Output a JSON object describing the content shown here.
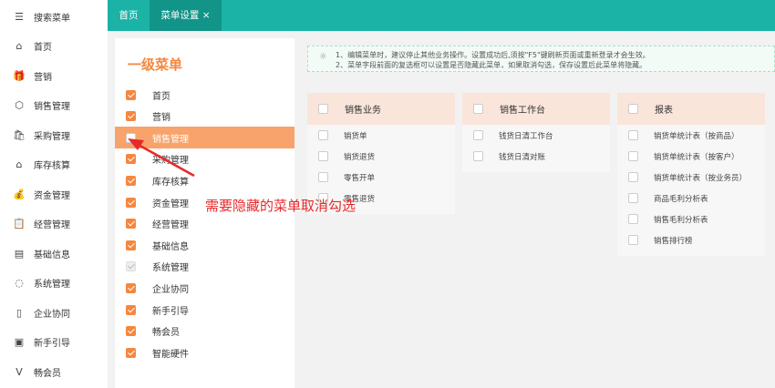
{
  "sidebar": {
    "items": [
      {
        "label": "搜索菜单",
        "icon": "search-menu-icon",
        "glyph": "☰"
      },
      {
        "label": "首页",
        "icon": "home-icon",
        "glyph": "⌂"
      },
      {
        "label": "营销",
        "icon": "gift-icon",
        "glyph": "🎁"
      },
      {
        "label": "销售管理",
        "icon": "sales-icon",
        "glyph": "⬡"
      },
      {
        "label": "采购管理",
        "icon": "bag-icon",
        "glyph": "🛍"
      },
      {
        "label": "库存核算",
        "icon": "warehouse-icon",
        "glyph": "⌂"
      },
      {
        "label": "资金管理",
        "icon": "money-bag-icon",
        "glyph": "💰"
      },
      {
        "label": "经营管理",
        "icon": "clipboard-icon",
        "glyph": "📋"
      },
      {
        "label": "基础信息",
        "icon": "id-card-icon",
        "glyph": "▤"
      },
      {
        "label": "系统管理",
        "icon": "loading-circle-icon",
        "glyph": "◌"
      },
      {
        "label": "企业协同",
        "icon": "document-icon",
        "glyph": "▯"
      },
      {
        "label": "新手引导",
        "icon": "guide-icon",
        "glyph": "▣"
      },
      {
        "label": "畅会员",
        "icon": "vip-icon",
        "glyph": "V"
      }
    ]
  },
  "tabs": [
    {
      "label": "首页"
    },
    {
      "label": "菜单设置",
      "close": "×"
    }
  ],
  "left_panel": {
    "title": "一级菜单",
    "items": [
      {
        "label": "首页",
        "state": "checked"
      },
      {
        "label": "营销",
        "state": "checked"
      },
      {
        "label": "销售管理",
        "state": "unchecked",
        "highlighted": true
      },
      {
        "label": "采购管理",
        "state": "checked"
      },
      {
        "label": "库存核算",
        "state": "checked"
      },
      {
        "label": "资金管理",
        "state": "checked"
      },
      {
        "label": "经营管理",
        "state": "checked"
      },
      {
        "label": "基础信息",
        "state": "checked"
      },
      {
        "label": "系统管理",
        "state": "disabled"
      },
      {
        "label": "企业协同",
        "state": "checked"
      },
      {
        "label": "新手引导",
        "state": "checked"
      },
      {
        "label": "畅会员",
        "state": "checked"
      },
      {
        "label": "智能硬件",
        "state": "checked"
      }
    ]
  },
  "notice": {
    "line1": "1、编辑菜单时，建议停止其他业务操作。设置成功后,须按\"F5\"键刷新页面或重新登录才会生效。",
    "line2": "2、菜单字段前面的复选框可以设置是否隐藏此菜单，如果取消勾选，保存设置后此菜单将隐藏。"
  },
  "columns": [
    {
      "header": "销售业务",
      "items": [
        "销货单",
        "销货退货",
        "零售开单",
        "零售退货"
      ]
    },
    {
      "header": "销售工作台",
      "items": [
        "钱货日清工作台",
        "钱货日清对账"
      ]
    },
    {
      "header": "报表",
      "items": [
        "销货单统计表（按商品）",
        "销货单统计表（按客户）",
        "销货单统计表（按业务员）",
        "商品毛利分析表",
        "销售毛利分析表",
        "销售排行榜"
      ]
    }
  ],
  "annotation": "需要隐藏的菜单取消勾选",
  "colors": {
    "teal": "#1bb3a6",
    "teal_dark": "#129488",
    "orange": "#f5873f",
    "highlight": "#f8a36b",
    "annotation": "#e8282a"
  }
}
